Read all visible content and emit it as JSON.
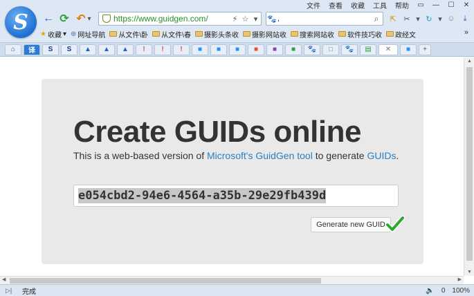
{
  "menubar": {
    "items": [
      "文件",
      "查看",
      "收藏",
      "工具",
      "帮助"
    ],
    "window_controls": [
      "▭",
      "—",
      "☐",
      "✕"
    ]
  },
  "nav": {
    "back_icon": "←",
    "refresh_icon": "⟳",
    "undo_icon": "↶",
    "undo_dropdown": "▾"
  },
  "address": {
    "url": "https://www.guidgen.com/",
    "bolt_icon": "⚡",
    "star_icon": "☆",
    "dropdown_icon": "▾"
  },
  "search": {
    "value": ",",
    "paw_icon": "🐾",
    "mag_icon": "⌕"
  },
  "tools": [
    "⇱",
    "✂",
    "▾",
    "↻",
    "▾",
    "☺",
    "⤓"
  ],
  "bookmarks": {
    "star_label": "收藏",
    "items": [
      "网址导航",
      "从文件\\卧",
      "从文件\\春",
      "摄影头条收",
      "摄影网站收",
      "搜索网站收",
      "软件技巧收",
      "政经文"
    ],
    "more": "»"
  },
  "tabs": {
    "items": [
      "⌂",
      "译",
      "S",
      "S",
      "▲",
      "▲",
      "▲",
      "!",
      "!",
      "!",
      "■",
      "■",
      "■",
      "■",
      "■",
      "■",
      "🐾",
      "□",
      "🐾",
      "▤",
      "✕",
      "■"
    ],
    "add": "+"
  },
  "page": {
    "title": "Create GUIDs online",
    "subtitle_pre": "This is a web-based version of ",
    "subtitle_link1": "Microsoft's GuidGen tool",
    "subtitle_mid": " to generate ",
    "subtitle_link2": "GUIDs",
    "subtitle_post": ".",
    "guid": "e054cbd2-94e6-4564-a35b-29e29fb439d",
    "button_label": "Generate new GUID"
  },
  "status": {
    "text": "完成",
    "volume_icon": "🔈",
    "zoom_label": "100%",
    "download_count": "0"
  },
  "colors": {
    "chrome": "#dde8f4",
    "link": "#2a7fc1",
    "url_green": "#2a8f2a",
    "card_bg": "#e9e9e9",
    "check_green": "#2fa82f"
  }
}
